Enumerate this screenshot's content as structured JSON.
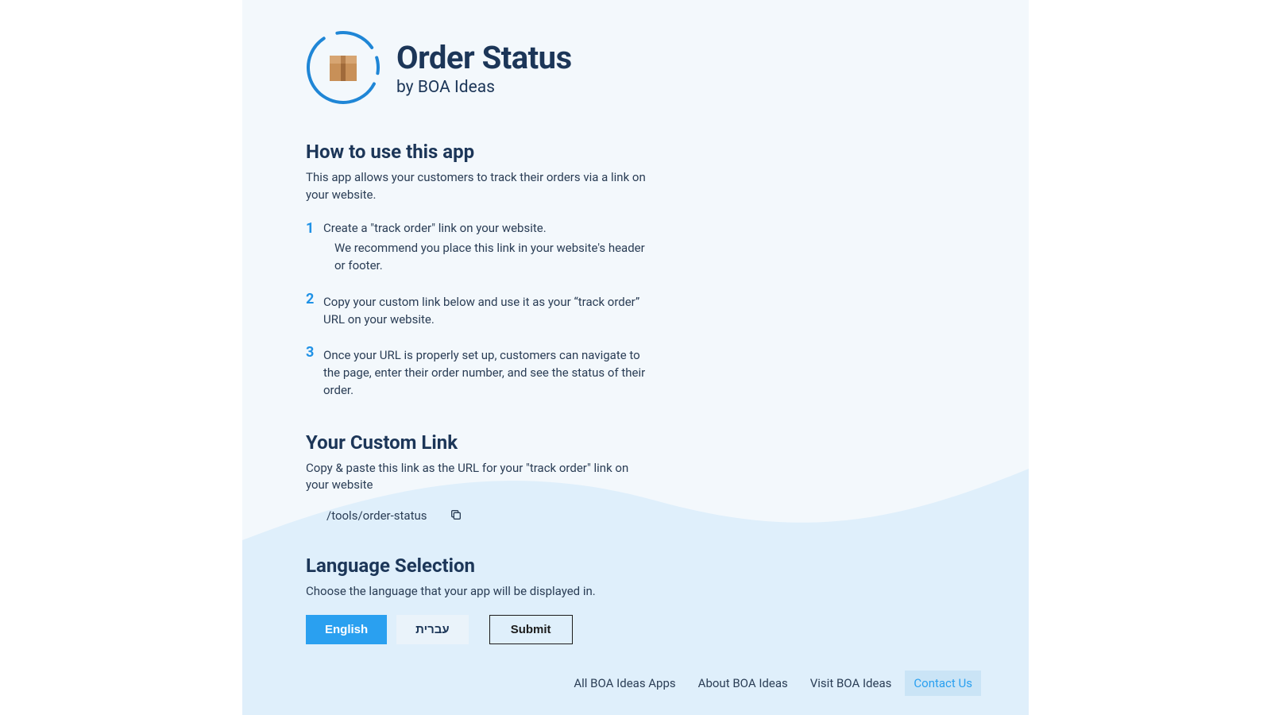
{
  "header": {
    "title": "Order Status",
    "byline": "by BOA Ideas"
  },
  "howto": {
    "heading": "How to use this app",
    "intro": "This app allows your customers to track their orders via a link on your website.",
    "steps": [
      {
        "num": "1",
        "line1": "Create a \"track order\" link on your website.",
        "line2": "We recommend you place this link in your website's header or footer."
      },
      {
        "num": "2",
        "line1": "Copy your custom link below and use it as your “track order” URL on your website.",
        "line2": ""
      },
      {
        "num": "3",
        "line1": "Once your URL is properly set up, customers can navigate to the page, enter their order number, and see the status of their order.",
        "line2": ""
      }
    ]
  },
  "customlink": {
    "heading": "Your Custom Link",
    "desc": "Copy & paste this link as the URL for your \"track order\" link on your website",
    "value": "/tools/order-status"
  },
  "language": {
    "heading": "Language Selection",
    "desc": "Choose the language that your app will be displayed in.",
    "options": [
      "English",
      "עברית"
    ],
    "selected": "English",
    "submit": "Submit"
  },
  "footer": {
    "links": [
      "All BOA Ideas Apps",
      "About BOA Ideas",
      "Visit BOA Ideas",
      "Contact Us"
    ],
    "active": "Contact Us"
  },
  "colors": {
    "accent": "#2aa0f0",
    "darktext": "#1c3658"
  }
}
